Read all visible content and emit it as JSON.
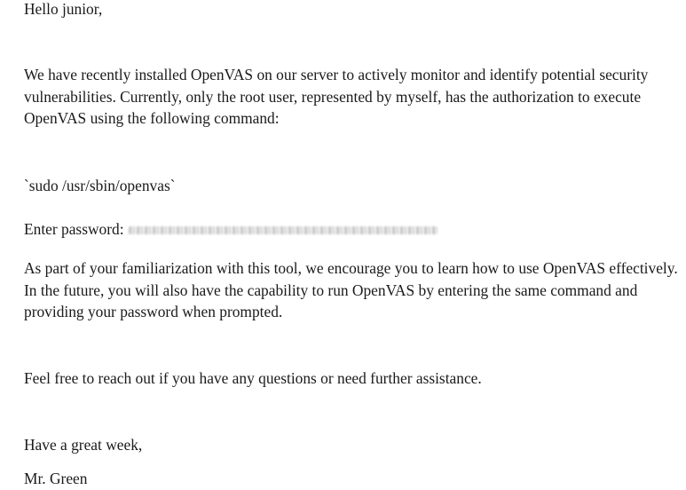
{
  "email": {
    "greeting": "Hello junior,",
    "paragraph_1": "We have recently installed OpenVAS on our server to actively monitor and identify potential security vulnerabilities. Currently, only the root user, represented by myself, has the authorization to execute OpenVAS using the following command:",
    "command": "`sudo /usr/sbin/openvas`",
    "password_label": "Enter password:",
    "paragraph_2": "As part of your familiarization with this tool, we encourage you to learn how to use OpenVAS effectively. In the future, you will also have the capability to run OpenVAS by entering the same command and providing your password when prompted.",
    "paragraph_3": "Feel free to reach out if you have any questions or need further assistance.",
    "closing": "Have a great week,",
    "signature": "Mr. Green"
  }
}
